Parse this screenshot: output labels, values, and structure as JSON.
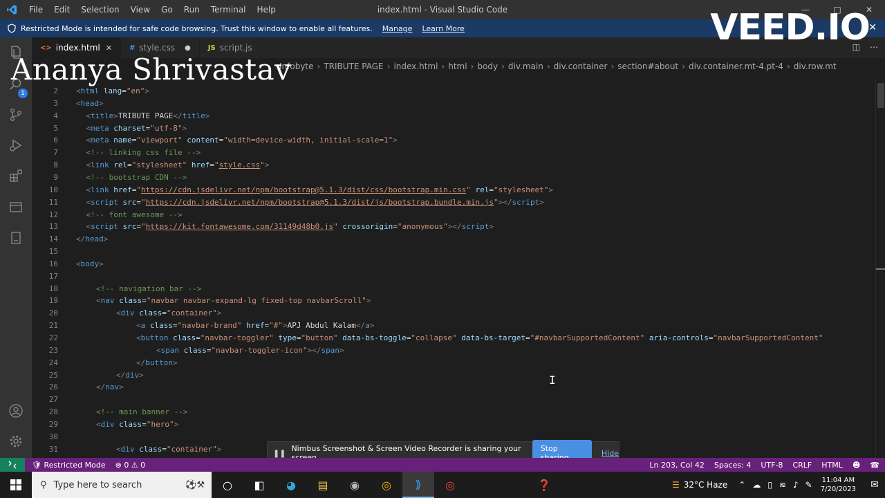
{
  "titlebar": {
    "menu": [
      "File",
      "Edit",
      "Selection",
      "View",
      "Go",
      "Run",
      "Terminal",
      "Help"
    ],
    "window_title": "index.html - Visual Studio Code"
  },
  "banner": {
    "message": "Restricted Mode is intended for safe code browsing. Trust this window to enable all features.",
    "manage": "Manage",
    "learn_more": "Learn More"
  },
  "activity": {
    "badge": "1"
  },
  "tabs": [
    {
      "icon": "<>",
      "label": "index.html",
      "state": "active"
    },
    {
      "icon": "#",
      "label": "style.css",
      "state": "modified"
    },
    {
      "icon": "JS",
      "label": "script.js",
      "state": "normal"
    }
  ],
  "breadcrumb": [
    "Infobyte",
    "TRIBUTE PAGE",
    "index.html",
    "html",
    "body",
    "div.main",
    "div.container",
    "section#about",
    "div.container.mt-4.pt-4",
    "div.row.mt"
  ],
  "editor": {
    "lines": [
      {
        "n": "2",
        "indent": 0,
        "tokens": [
          [
            "tg",
            "<"
          ],
          [
            "tn",
            "html"
          ],
          [
            "tx",
            " "
          ],
          [
            "an",
            "lang"
          ],
          [
            "tx",
            "="
          ],
          [
            "av",
            "\"en\""
          ],
          [
            "tg",
            ">"
          ]
        ]
      },
      {
        "n": "3",
        "indent": 0,
        "tokens": [
          [
            "tg",
            "<"
          ],
          [
            "tn",
            "head"
          ],
          [
            "tg",
            ">"
          ]
        ]
      },
      {
        "n": "4",
        "indent": 1,
        "tokens": [
          [
            "tg",
            "<"
          ],
          [
            "tn",
            "title"
          ],
          [
            "tg",
            ">"
          ],
          [
            "tx",
            "TRIBUTE PAGE"
          ],
          [
            "tg",
            "</"
          ],
          [
            "tn",
            "title"
          ],
          [
            "tg",
            ">"
          ]
        ]
      },
      {
        "n": "5",
        "indent": 1,
        "tokens": [
          [
            "tg",
            "<"
          ],
          [
            "tn",
            "meta"
          ],
          [
            "tx",
            " "
          ],
          [
            "an",
            "charset"
          ],
          [
            "tx",
            "="
          ],
          [
            "av",
            "\"utf-8\""
          ],
          [
            "tg",
            ">"
          ]
        ]
      },
      {
        "n": "6",
        "indent": 1,
        "tokens": [
          [
            "tg",
            "<"
          ],
          [
            "tn",
            "meta"
          ],
          [
            "tx",
            " "
          ],
          [
            "an",
            "name"
          ],
          [
            "tx",
            "="
          ],
          [
            "av",
            "\"viewport\""
          ],
          [
            "tx",
            " "
          ],
          [
            "an",
            "content"
          ],
          [
            "tx",
            "="
          ],
          [
            "av",
            "\"width=device-width, initial-scale=1\""
          ],
          [
            "tg",
            ">"
          ]
        ]
      },
      {
        "n": "7",
        "indent": 1,
        "tokens": [
          [
            "cm",
            "<!-- linking css file -->"
          ]
        ]
      },
      {
        "n": "8",
        "indent": 1,
        "tokens": [
          [
            "tg",
            "<"
          ],
          [
            "tn",
            "link"
          ],
          [
            "tx",
            " "
          ],
          [
            "an",
            "rel"
          ],
          [
            "tx",
            "="
          ],
          [
            "av",
            "\"stylesheet\""
          ],
          [
            "tx",
            " "
          ],
          [
            "an",
            "href"
          ],
          [
            "tx",
            "="
          ],
          [
            "av",
            "\""
          ],
          [
            "url",
            "style.css"
          ],
          [
            "av",
            "\""
          ],
          [
            "tg",
            ">"
          ]
        ]
      },
      {
        "n": "9",
        "indent": 1,
        "tokens": [
          [
            "cm",
            "<!-- bootstrap CDN -->"
          ]
        ]
      },
      {
        "n": "10",
        "indent": 1,
        "tokens": [
          [
            "tg",
            "<"
          ],
          [
            "tn",
            "link"
          ],
          [
            "tx",
            " "
          ],
          [
            "an",
            "href"
          ],
          [
            "tx",
            "="
          ],
          [
            "av",
            "\""
          ],
          [
            "url",
            "https://cdn.jsdelivr.net/npm/bootstrap@5.1.3/dist/css/bootstrap.min.css"
          ],
          [
            "av",
            "\""
          ],
          [
            "tx",
            " "
          ],
          [
            "an",
            "rel"
          ],
          [
            "tx",
            "="
          ],
          [
            "av",
            "\"stylesheet\""
          ],
          [
            "tg",
            ">"
          ]
        ]
      },
      {
        "n": "11",
        "indent": 1,
        "tokens": [
          [
            "tg",
            "<"
          ],
          [
            "tn",
            "script"
          ],
          [
            "tx",
            " "
          ],
          [
            "an",
            "src"
          ],
          [
            "tx",
            "="
          ],
          [
            "av",
            "\""
          ],
          [
            "url",
            "https://cdn.jsdelivr.net/npm/bootstrap@5.1.3/dist/js/bootstrap.bundle.min.js"
          ],
          [
            "av",
            "\""
          ],
          [
            "tg",
            "></"
          ],
          [
            "tn",
            "script"
          ],
          [
            "tg",
            ">"
          ]
        ]
      },
      {
        "n": "12",
        "indent": 1,
        "tokens": [
          [
            "cm",
            "<!-- font awesome -->"
          ]
        ]
      },
      {
        "n": "13",
        "indent": 1,
        "tokens": [
          [
            "tg",
            "<"
          ],
          [
            "tn",
            "script"
          ],
          [
            "tx",
            " "
          ],
          [
            "an",
            "src"
          ],
          [
            "tx",
            "="
          ],
          [
            "av",
            "\""
          ],
          [
            "url",
            "https://kit.fontawesome.com/31149d48b0.js"
          ],
          [
            "av",
            "\""
          ],
          [
            "tx",
            " "
          ],
          [
            "an",
            "crossorigin"
          ],
          [
            "tx",
            "="
          ],
          [
            "av",
            "\"anonymous\""
          ],
          [
            "tg",
            "></"
          ],
          [
            "tn",
            "script"
          ],
          [
            "tg",
            ">"
          ]
        ]
      },
      {
        "n": "14",
        "indent": 0,
        "tokens": [
          [
            "tg",
            "</"
          ],
          [
            "tn",
            "head"
          ],
          [
            "tg",
            ">"
          ]
        ]
      },
      {
        "n": "15",
        "indent": 0,
        "tokens": []
      },
      {
        "n": "16",
        "indent": 0,
        "tokens": [
          [
            "tg",
            "<"
          ],
          [
            "tn",
            "body"
          ],
          [
            "tg",
            ">"
          ]
        ]
      },
      {
        "n": "17",
        "indent": 0,
        "tokens": []
      },
      {
        "n": "18",
        "indent": 2,
        "tokens": [
          [
            "cm",
            "<!-- navigation bar -->"
          ]
        ]
      },
      {
        "n": "19",
        "indent": 2,
        "tokens": [
          [
            "tg",
            "<"
          ],
          [
            "tn",
            "nav"
          ],
          [
            "tx",
            " "
          ],
          [
            "an",
            "class"
          ],
          [
            "tx",
            "="
          ],
          [
            "av",
            "\"navbar navbar-expand-lg fixed-top navbarScroll\""
          ],
          [
            "tg",
            ">"
          ]
        ]
      },
      {
        "n": "20",
        "indent": 4,
        "tokens": [
          [
            "tg",
            "<"
          ],
          [
            "tn",
            "div"
          ],
          [
            "tx",
            " "
          ],
          [
            "an",
            "class"
          ],
          [
            "tx",
            "="
          ],
          [
            "av",
            "\"container\""
          ],
          [
            "tg",
            ">"
          ]
        ]
      },
      {
        "n": "21",
        "indent": 6,
        "tokens": [
          [
            "tg",
            "<"
          ],
          [
            "tn",
            "a"
          ],
          [
            "tx",
            " "
          ],
          [
            "an",
            "class"
          ],
          [
            "tx",
            "="
          ],
          [
            "av",
            "\"navbar-brand\""
          ],
          [
            "tx",
            " "
          ],
          [
            "an",
            "href"
          ],
          [
            "tx",
            "="
          ],
          [
            "av",
            "\"#\""
          ],
          [
            "tg",
            ">"
          ],
          [
            "tx",
            "APJ Abdul Kalam"
          ],
          [
            "tg",
            "</"
          ],
          [
            "tn",
            "a"
          ],
          [
            "tg",
            ">"
          ]
        ]
      },
      {
        "n": "22",
        "indent": 6,
        "tokens": [
          [
            "tg",
            "<"
          ],
          [
            "tn",
            "button"
          ],
          [
            "tx",
            " "
          ],
          [
            "an",
            "class"
          ],
          [
            "tx",
            "="
          ],
          [
            "av",
            "\"navbar-toggler\""
          ],
          [
            "tx",
            " "
          ],
          [
            "an",
            "type"
          ],
          [
            "tx",
            "="
          ],
          [
            "av",
            "\"button\""
          ],
          [
            "tx",
            " "
          ],
          [
            "an",
            "data-bs-toggle"
          ],
          [
            "tx",
            "="
          ],
          [
            "av",
            "\"collapse\""
          ],
          [
            "tx",
            " "
          ],
          [
            "an",
            "data-bs-target"
          ],
          [
            "tx",
            "="
          ],
          [
            "av",
            "\"#navbarSupportedContent\""
          ],
          [
            "tx",
            " "
          ],
          [
            "an",
            "aria-controls"
          ],
          [
            "tx",
            "="
          ],
          [
            "av",
            "\"navbarSupportedContent\""
          ]
        ]
      },
      {
        "n": "23",
        "indent": 8,
        "tokens": [
          [
            "tg",
            "<"
          ],
          [
            "tn",
            "span"
          ],
          [
            "tx",
            " "
          ],
          [
            "an",
            "class"
          ],
          [
            "tx",
            "="
          ],
          [
            "av",
            "\"navbar-toggler-icon\""
          ],
          [
            "tg",
            "></"
          ],
          [
            "tn",
            "span"
          ],
          [
            "tg",
            ">"
          ]
        ]
      },
      {
        "n": "24",
        "indent": 6,
        "tokens": [
          [
            "tg",
            "</"
          ],
          [
            "tn",
            "button"
          ],
          [
            "tg",
            ">"
          ]
        ]
      },
      {
        "n": "25",
        "indent": 4,
        "tokens": [
          [
            "tg",
            "</"
          ],
          [
            "tn",
            "div"
          ],
          [
            "tg",
            ">"
          ]
        ]
      },
      {
        "n": "26",
        "indent": 2,
        "tokens": [
          [
            "tg",
            "</"
          ],
          [
            "tn",
            "nav"
          ],
          [
            "tg",
            ">"
          ]
        ]
      },
      {
        "n": "27",
        "indent": 0,
        "tokens": []
      },
      {
        "n": "28",
        "indent": 2,
        "tokens": [
          [
            "cm",
            "<!-- main banner -->"
          ]
        ]
      },
      {
        "n": "29",
        "indent": 2,
        "tokens": [
          [
            "tg",
            "<"
          ],
          [
            "tn",
            "div"
          ],
          [
            "tx",
            " "
          ],
          [
            "an",
            "class"
          ],
          [
            "tx",
            "="
          ],
          [
            "av",
            "\"hero\""
          ],
          [
            "tg",
            ">"
          ]
        ]
      },
      {
        "n": "30",
        "indent": 0,
        "tokens": []
      },
      {
        "n": "31",
        "indent": 4,
        "tokens": [
          [
            "tg",
            "<"
          ],
          [
            "tn",
            "div"
          ],
          [
            "tx",
            " "
          ],
          [
            "an",
            "class"
          ],
          [
            "tx",
            "="
          ],
          [
            "av",
            "\"container\""
          ],
          [
            "tg",
            ">"
          ]
        ]
      }
    ]
  },
  "statusbar": {
    "mode": "Restricted Mode",
    "problems": "0",
    "warnings": "0",
    "position": "Ln 203, Col 42",
    "spaces": "Spaces: 4",
    "encoding": "UTF-8",
    "eol": "CRLF",
    "language": "HTML"
  },
  "sharebar": {
    "message": "Nimbus Screenshot & Screen Video Recorder is sharing your screen.",
    "stop": "Stop sharing",
    "hide": "Hide"
  },
  "taskbar": {
    "search_placeholder": "Type here to search",
    "weather": "32°C  Haze",
    "time": "11:04 AM",
    "date": "7/20/2023"
  },
  "overlay": {
    "name": "Ananya Shrivastav",
    "logo": "VEED.IO"
  },
  "colors": {
    "status_bar": "#68217a",
    "banner": "#1b3a66",
    "accent": "#007acc"
  }
}
